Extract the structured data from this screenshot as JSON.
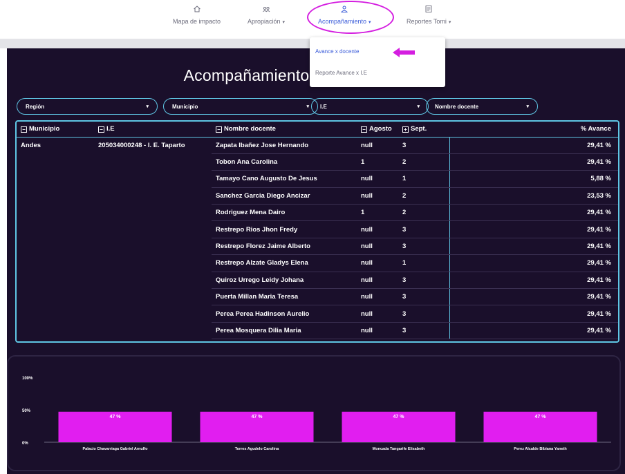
{
  "nav": {
    "items": [
      {
        "label": "Mapa de impacto",
        "icon": "home-icon",
        "caret": ""
      },
      {
        "label": "Apropiación",
        "icon": "users-icon",
        "caret": "▾"
      },
      {
        "label": "Acompañamiento",
        "icon": "user-group-icon",
        "caret": "▾"
      },
      {
        "label": "Reportes Tomi",
        "icon": "report-icon",
        "caret": "▾"
      }
    ],
    "dropdown": {
      "selected": "Avance x docente",
      "other": "Reporte Avance x I.E"
    }
  },
  "title": "Acompañamiento Avance x docente",
  "filters": [
    {
      "label": "Región",
      "caret": "▾"
    },
    {
      "label": "Municipio",
      "caret": "▾"
    },
    {
      "label": "I.E",
      "caret": "▾"
    },
    {
      "label": "Nombre docente",
      "caret": "▾"
    }
  ],
  "table": {
    "headers": {
      "municipio": "Municipio",
      "ie": "I.E",
      "docente": "Nombre docente",
      "agosto": "Agosto",
      "sept": "Sept.",
      "avance": "% Avance"
    },
    "group": {
      "municipio": "Andes",
      "ie": "205034000248 - I. E. Taparto"
    },
    "rows": [
      {
        "docente": "Zapata Ibañez Jose Hernando",
        "agosto": "null",
        "sept": "3",
        "avance": "29,41 %"
      },
      {
        "docente": "Tobon Ana Carolina",
        "agosto": "1",
        "sept": "2",
        "avance": "29,41 %"
      },
      {
        "docente": "Tamayo Cano Augusto De Jesus",
        "agosto": "null",
        "sept": "1",
        "avance": "5,88 %"
      },
      {
        "docente": "Sanchez Garcia Diego Ancizar",
        "agosto": "null",
        "sept": "2",
        "avance": "23,53 %"
      },
      {
        "docente": "Rodriguez Mena Dairo",
        "agosto": "1",
        "sept": "2",
        "avance": "29,41 %"
      },
      {
        "docente": "Restrepo Rios Jhon Fredy",
        "agosto": "null",
        "sept": "3",
        "avance": "29,41 %"
      },
      {
        "docente": "Restrepo Florez Jaime Alberto",
        "agosto": "null",
        "sept": "3",
        "avance": "29,41 %"
      },
      {
        "docente": "Restrepo Alzate Gladys Elena",
        "agosto": "null",
        "sept": "1",
        "avance": "29,41 %"
      },
      {
        "docente": "Quiroz Urrego Leidy Johana",
        "agosto": "null",
        "sept": "3",
        "avance": "29,41 %"
      },
      {
        "docente": "Puerta Millan Maria Teresa",
        "agosto": "null",
        "sept": "3",
        "avance": "29,41 %"
      },
      {
        "docente": "Perea Perea Hadinson Aurelio",
        "agosto": "null",
        "sept": "3",
        "avance": "29,41 %"
      },
      {
        "docente": "Perea Mosquera Dilia Maria",
        "agosto": "null",
        "sept": "3",
        "avance": "29,41 %"
      }
    ]
  },
  "colors": {
    "bar": "#e11ef0",
    "accent": "#5fc6e4",
    "background": "#1a0f2b",
    "nav_active": "#3a5bd9"
  },
  "chart_data": {
    "type": "bar",
    "categories": [
      "Palacio Chavarriaga Gabriel Arnulfo",
      "Torres Agudelo Carolina",
      "Moncada Tangarife Elisabeth",
      "Perez Alcalde Bibiana Yaneth"
    ],
    "values": [
      47,
      47,
      47,
      47
    ],
    "data_labels": [
      "47 %",
      "47 %",
      "47 %",
      "47 %"
    ],
    "y_ticks": [
      "0%",
      "50%",
      "100%"
    ],
    "ylim": [
      0,
      100
    ],
    "grid": false,
    "legend": "none"
  }
}
